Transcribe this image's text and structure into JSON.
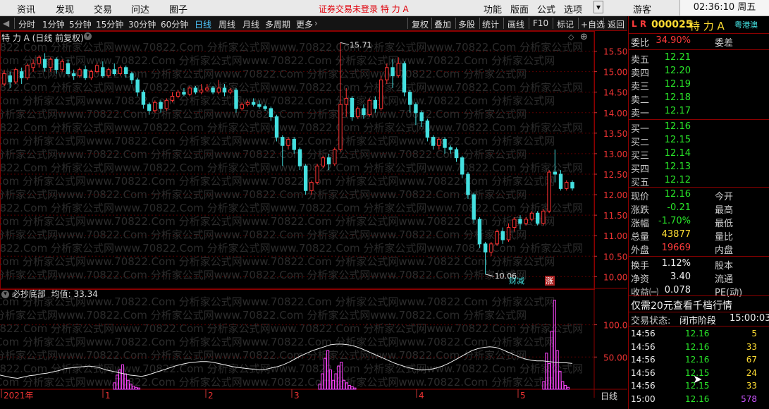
{
  "menu": {
    "items": [
      "资讯",
      "发现",
      "交易",
      "问达",
      "圈子"
    ],
    "notice": "证券交易未登录  特 力 A",
    "right_items": [
      "功能",
      "版面",
      "公式",
      "选项"
    ],
    "guest": "游客",
    "clock": "02:36:10 周五"
  },
  "toolbar": {
    "periods": [
      "分时",
      "1分钟",
      "5分钟",
      "15分钟",
      "30分钟",
      "60分钟",
      "日线",
      "周线",
      "月线",
      "多周期",
      "更多"
    ],
    "active": "日线",
    "right": [
      "复权",
      "叠加",
      "多股",
      "统计",
      "画线",
      "F10",
      "标记",
      "+自选",
      "返回"
    ]
  },
  "main_panel": {
    "title": "特 力 A (日线 前复权)",
    "price_ticks": [
      "15.50",
      "15.00",
      "14.50",
      "14.00",
      "13.50",
      "13.00",
      "12.50",
      "12.00",
      "11.50",
      "11.00",
      "10.50",
      "10.00"
    ],
    "high_label": "15.71",
    "low_label": "10.06",
    "signal_buy": "财减",
    "signal_rise": "涨",
    "watermark": "0822.Com 分析家公式网www.70822.Com 分析家公式网www.70822.Com 分析家公式网www.70822.Com 分析家公式网"
  },
  "sub_panel": {
    "title": "必抄底部",
    "value_label": "均值: 33.34",
    "ticks": [
      "100.0",
      "50.00"
    ]
  },
  "x_axis": {
    "labels": [
      "2021年",
      "1",
      "2",
      "3",
      "4",
      "5"
    ],
    "period_tab": "日线"
  },
  "quote": {
    "code": "000025",
    "name": "特 力 A",
    "badge": "粤港澳",
    "lr": "L R",
    "wb_label": "委比",
    "wb_value": "34.90%",
    "wc_label": "委差",
    "asks": [
      {
        "label": "卖五",
        "price": "12.21"
      },
      {
        "label": "卖四",
        "price": "12.20"
      },
      {
        "label": "卖三",
        "price": "12.19"
      },
      {
        "label": "卖二",
        "price": "12.18"
      },
      {
        "label": "卖一",
        "price": "12.17"
      }
    ],
    "bids": [
      {
        "label": "买一",
        "price": "12.16"
      },
      {
        "label": "买二",
        "price": "12.15"
      },
      {
        "label": "买三",
        "price": "12.14"
      },
      {
        "label": "买四",
        "price": "12.13"
      },
      {
        "label": "买五",
        "price": "12.12"
      }
    ],
    "stats": [
      {
        "l": "现价",
        "v": "12.16",
        "c": "green",
        "l2": "今开"
      },
      {
        "l": "涨跌",
        "v": "-0.21",
        "c": "green",
        "l2": "最高"
      },
      {
        "l": "涨幅",
        "v": "-1.70%",
        "c": "green",
        "l2": "最低"
      },
      {
        "l": "总量",
        "v": "43877",
        "c": "yellow",
        "l2": "量比"
      },
      {
        "l": "外盘",
        "v": "19669",
        "c": "red",
        "l2": "内盘"
      },
      {
        "l": "换手",
        "v": "1.12%",
        "c": "white",
        "l2": "股本"
      },
      {
        "l": "净资",
        "v": "3.40",
        "c": "white",
        "l2": "流通"
      },
      {
        "l": "收益㈠",
        "v": "0.078",
        "c": "white",
        "l2": "PE(动)"
      }
    ],
    "promo": "仅需20元查看千档行情",
    "trade_state_label": "交易状态:",
    "trade_state": "闭市阶段",
    "trade_time": "15:00:03",
    "ticks": [
      {
        "t": "14:56",
        "p": "12.16",
        "v": "5",
        "pc": "green",
        "vc": "yellow"
      },
      {
        "t": "14:56",
        "p": "12.16",
        "v": "33",
        "pc": "green",
        "vc": "yellow"
      },
      {
        "t": "14:56",
        "p": "12.16",
        "v": "67",
        "pc": "green",
        "vc": "yellow"
      },
      {
        "t": "14:56",
        "p": "12.15",
        "v": "24",
        "pc": "green",
        "vc": "yellow"
      },
      {
        "t": "14:56",
        "p": "12.15",
        "v": "33",
        "pc": "green",
        "vc": "yellow"
      },
      {
        "t": "15:00",
        "p": "12.16",
        "v": "578",
        "pc": "green",
        "vc": "purple"
      }
    ]
  },
  "chart_data": {
    "type": "candlestick",
    "ylim": [
      9.8,
      15.75
    ],
    "candles": [
      [
        14.7,
        14.95,
        14.65,
        15.05
      ],
      [
        14.9,
        14.75,
        14.6,
        15.0
      ],
      [
        14.75,
        15.05,
        14.7,
        15.1
      ],
      [
        15.0,
        14.85,
        14.7,
        15.1
      ],
      [
        14.85,
        15.15,
        14.8,
        15.2
      ],
      [
        15.1,
        15.2,
        15.0,
        15.3
      ],
      [
        15.2,
        15.35,
        15.1,
        15.4
      ],
      [
        15.3,
        15.1,
        15.0,
        15.45
      ],
      [
        15.1,
        15.3,
        15.0,
        15.35
      ],
      [
        15.3,
        15.05,
        14.95,
        15.35
      ],
      [
        15.05,
        15.25,
        15.0,
        15.3
      ],
      [
        15.2,
        14.95,
        14.9,
        15.3
      ],
      [
        14.95,
        14.9,
        14.8,
        15.05
      ],
      [
        14.9,
        15.05,
        14.85,
        15.1
      ],
      [
        15.05,
        14.85,
        14.8,
        15.15
      ],
      [
        14.85,
        15.0,
        14.8,
        15.05
      ],
      [
        15.0,
        15.15,
        14.95,
        15.2
      ],
      [
        15.1,
        14.9,
        14.85,
        15.25
      ],
      [
        14.9,
        15.05,
        14.85,
        15.1
      ],
      [
        15.05,
        14.95,
        14.9,
        15.2
      ],
      [
        14.95,
        15.1,
        14.9,
        15.15
      ],
      [
        15.1,
        14.95,
        14.85,
        15.15
      ],
      [
        14.95,
        14.8,
        14.7,
        15.0
      ],
      [
        14.8,
        14.5,
        14.4,
        14.85
      ],
      [
        14.5,
        14.2,
        14.1,
        14.55
      ],
      [
        14.2,
        14.05,
        13.95,
        14.25
      ],
      [
        14.05,
        14.25,
        14.0,
        14.3
      ],
      [
        14.25,
        14.1,
        14.0,
        14.3
      ],
      [
        14.1,
        14.3,
        14.05,
        14.35
      ],
      [
        14.3,
        14.4,
        14.25,
        14.5
      ],
      [
        14.4,
        14.5,
        14.35,
        14.55
      ],
      [
        14.5,
        14.45,
        14.4,
        14.6
      ],
      [
        14.45,
        14.6,
        14.4,
        14.65
      ],
      [
        14.6,
        14.5,
        14.45,
        14.65
      ],
      [
        14.5,
        14.55,
        14.45,
        14.7
      ],
      [
        14.55,
        14.6,
        14.5,
        14.7
      ],
      [
        14.6,
        14.5,
        14.45,
        14.65
      ],
      [
        14.5,
        14.6,
        14.45,
        14.8
      ],
      [
        14.6,
        14.5,
        14.4,
        14.7
      ],
      [
        14.5,
        14.55,
        14.45,
        14.6
      ],
      [
        14.55,
        14.1,
        14.0,
        14.6
      ],
      [
        14.1,
        14.2,
        14.05,
        14.25
      ],
      [
        14.2,
        14.25,
        14.15,
        14.3
      ],
      [
        14.25,
        14.2,
        14.15,
        14.35
      ],
      [
        14.2,
        14.15,
        14.1,
        14.3
      ],
      [
        14.15,
        14.1,
        14.05,
        14.2
      ],
      [
        14.1,
        13.9,
        13.8,
        14.15
      ],
      [
        13.9,
        13.4,
        13.3,
        13.95
      ],
      [
        13.4,
        13.2,
        12.7,
        13.45
      ],
      [
        13.2,
        13.35,
        13.1,
        13.4
      ],
      [
        13.35,
        13.1,
        13.0,
        13.4
      ],
      [
        13.1,
        12.7,
        12.6,
        13.15
      ],
      [
        12.7,
        12.1,
        12.0,
        12.75
      ],
      [
        12.1,
        12.3,
        12.0,
        12.35
      ],
      [
        12.3,
        12.7,
        12.25,
        12.75
      ],
      [
        12.7,
        12.9,
        12.65,
        12.95
      ],
      [
        12.9,
        12.75,
        12.6,
        13.0
      ],
      [
        12.75,
        13.1,
        12.7,
        13.15
      ],
      [
        13.1,
        14.2,
        13.05,
        15.71
      ],
      [
        14.2,
        14.35,
        13.9,
        14.6
      ],
      [
        14.35,
        13.9,
        13.8,
        14.4
      ],
      [
        13.9,
        14.1,
        13.85,
        14.15
      ],
      [
        14.1,
        13.95,
        13.85,
        14.2
      ],
      [
        13.95,
        14.3,
        13.9,
        14.35
      ],
      [
        14.3,
        14.1,
        14.0,
        14.4
      ],
      [
        14.1,
        14.8,
        14.05,
        14.9
      ],
      [
        14.8,
        15.1,
        14.7,
        15.2
      ],
      [
        15.1,
        14.9,
        14.6,
        15.3
      ],
      [
        14.9,
        15.2,
        14.85,
        15.35
      ],
      [
        15.2,
        14.5,
        14.4,
        15.25
      ],
      [
        14.5,
        14.2,
        14.0,
        14.55
      ],
      [
        14.2,
        14.0,
        13.7,
        14.25
      ],
      [
        14.0,
        13.8,
        13.65,
        14.05
      ],
      [
        13.8,
        13.4,
        13.3,
        13.85
      ],
      [
        13.4,
        13.2,
        13.1,
        13.45
      ],
      [
        13.2,
        13.35,
        13.1,
        13.4
      ],
      [
        13.35,
        13.15,
        13.0,
        13.4
      ],
      [
        13.15,
        13.1,
        13.0,
        13.2
      ],
      [
        13.1,
        12.9,
        12.8,
        13.15
      ],
      [
        12.9,
        12.5,
        12.4,
        12.95
      ],
      [
        12.5,
        12.0,
        11.9,
        12.55
      ],
      [
        12.0,
        11.4,
        11.3,
        12.05
      ],
      [
        11.4,
        10.8,
        10.7,
        11.45
      ],
      [
        10.8,
        10.6,
        10.06,
        10.85
      ],
      [
        10.6,
        10.8,
        10.5,
        10.85
      ],
      [
        10.8,
        11.1,
        10.75,
        11.15
      ],
      [
        11.1,
        10.9,
        10.8,
        11.2
      ],
      [
        10.9,
        11.2,
        10.85,
        11.3
      ],
      [
        11.2,
        11.4,
        11.1,
        11.45
      ],
      [
        11.4,
        11.3,
        11.15,
        11.5
      ],
      [
        11.3,
        11.4,
        11.25,
        11.45
      ],
      [
        11.4,
        11.55,
        11.35,
        11.6
      ],
      [
        11.55,
        11.3,
        11.25,
        11.6
      ],
      [
        11.3,
        11.6,
        11.25,
        11.65
      ],
      [
        11.6,
        12.55,
        11.55,
        12.6
      ],
      [
        12.55,
        12.5,
        12.3,
        13.1
      ],
      [
        12.5,
        12.15,
        12.1,
        12.6
      ],
      [
        12.15,
        12.3,
        12.1,
        12.35
      ],
      [
        12.3,
        12.16,
        12.1,
        12.35
      ]
    ],
    "sub": {
      "ylim": [
        0,
        140
      ],
      "line": [
        22,
        20,
        18,
        17,
        19,
        21,
        22,
        24,
        25,
        27,
        29,
        32,
        33,
        34,
        35,
        36,
        35,
        33,
        30,
        28,
        26,
        24,
        22,
        21,
        20,
        22,
        25,
        28,
        31,
        34,
        37,
        39,
        41,
        42,
        43,
        43,
        42,
        40,
        38,
        36,
        34,
        33,
        32,
        31,
        30,
        31,
        33,
        35,
        38,
        42,
        47,
        52,
        56,
        60,
        63,
        66,
        69,
        70,
        70,
        69,
        67,
        64,
        60,
        56,
        52,
        48,
        44,
        40,
        37,
        34,
        32,
        30,
        30,
        31,
        33,
        36,
        40,
        45,
        50,
        55,
        60,
        63,
        65,
        66,
        65,
        62,
        58,
        54,
        50,
        47,
        45,
        44,
        44,
        43,
        42,
        41,
        41,
        40
      ],
      "bars": [
        0,
        0,
        0,
        0,
        0,
        0,
        0,
        0,
        0,
        0,
        0,
        0,
        0,
        0,
        0,
        0,
        0,
        0,
        0,
        0,
        0,
        0,
        0,
        0,
        0,
        0,
        0,
        0,
        0,
        0,
        0,
        0,
        0,
        0,
        0,
        0,
        0,
        0,
        0,
        0,
        0,
        0,
        0,
        0,
        0,
        0,
        0,
        0,
        0,
        0,
        0,
        0,
        0,
        0,
        0,
        0,
        0,
        0,
        0,
        0,
        0,
        0,
        0,
        0,
        0,
        0,
        0,
        0,
        0,
        0,
        0,
        0,
        0,
        0,
        0,
        0,
        0,
        0,
        0,
        0,
        0,
        0,
        0,
        0,
        0,
        0,
        0,
        0,
        0,
        0,
        0,
        0,
        0,
        0,
        0,
        0,
        0,
        0,
        0,
        0,
        0
      ]
    },
    "histo": [
      {
        "i": 42,
        "v": 10
      },
      {
        "i": 43,
        "v": 22
      },
      {
        "i": 44,
        "v": 30
      },
      {
        "i": 45,
        "v": 38
      },
      {
        "i": 46,
        "v": 24
      },
      {
        "i": 47,
        "v": 14
      },
      {
        "i": 48,
        "v": 8
      },
      {
        "i": 49,
        "v": 5
      },
      {
        "i": 50,
        "v": 3
      },
      {
        "i": 51,
        "v": 2
      },
      {
        "i": 118,
        "v": 8
      },
      {
        "i": 119,
        "v": 24
      },
      {
        "i": 120,
        "v": 48
      },
      {
        "i": 121,
        "v": 60
      },
      {
        "i": 122,
        "v": 30
      },
      {
        "i": 123,
        "v": 14
      },
      {
        "i": 124,
        "v": 24
      },
      {
        "i": 125,
        "v": 36
      },
      {
        "i": 126,
        "v": 42
      },
      {
        "i": 127,
        "v": 14
      },
      {
        "i": 128,
        "v": 10
      },
      {
        "i": 129,
        "v": 6
      },
      {
        "i": 130,
        "v": 4
      },
      {
        "i": 131,
        "v": 2
      },
      {
        "i": 201,
        "v": 12
      },
      {
        "i": 202,
        "v": 56
      },
      {
        "i": 203,
        "v": 40
      },
      {
        "i": 204,
        "v": 90
      },
      {
        "i": 205,
        "v": 138
      },
      {
        "i": 206,
        "v": 60
      },
      {
        "i": 207,
        "v": 28
      },
      {
        "i": 208,
        "v": 12
      },
      {
        "i": 209,
        "v": 6
      },
      {
        "i": 210,
        "v": 3
      }
    ]
  }
}
